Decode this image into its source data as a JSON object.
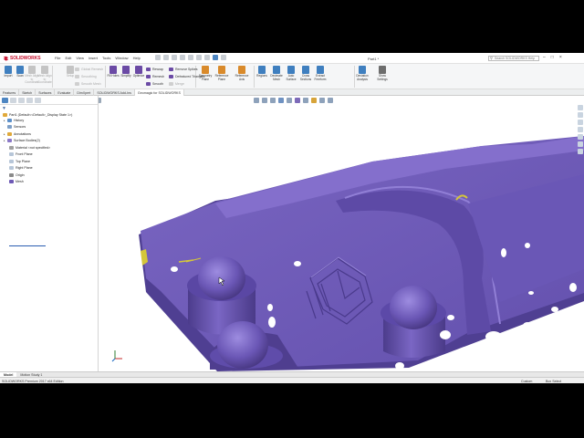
{
  "app": {
    "logo_text": "SOLIDWORKS",
    "menus": [
      "File",
      "Edit",
      "View",
      "Insert",
      "Tools",
      "Window",
      "Help"
    ],
    "document_title": "Part1 *",
    "search_placeholder": "Search SOLIDWORKS Help"
  },
  "ribbon": {
    "large_buttons": [
      {
        "label": "Import",
        "color": "#3f7fbf",
        "dim": false
      },
      {
        "label": "Scan",
        "color": "#3f7fbf",
        "dim": false
      },
      {
        "label": "Mesh Align to Coordinate",
        "color": "#c4c4c4",
        "dim": true
      },
      {
        "label": "Mesh Align to Coordinate",
        "color": "#c4c4c4",
        "dim": true
      },
      {
        "label": "Setup",
        "color": "#c4c4c4",
        "dim": true
      },
      {
        "label": "Fill Holes",
        "color": "#6b4aa5",
        "dim": false
      },
      {
        "label": "Simplify",
        "color": "#6b4aa5",
        "dim": false
      },
      {
        "label": "Optimize",
        "color": "#6b4aa5",
        "dim": false
      },
      {
        "label": "Symmetry Plane",
        "color": "#d98a2b",
        "dim": false
      },
      {
        "label": "Reference Plane",
        "color": "#d98a2b",
        "dim": false
      },
      {
        "label": "Reference Axis",
        "color": "#d98a2b",
        "dim": false
      },
      {
        "label": "Regions",
        "color": "#3f7fbf",
        "dim": false
      },
      {
        "label": "Decimate Mesh",
        "color": "#3f7fbf",
        "dim": false
      },
      {
        "label": "Auto Surface",
        "color": "#3f7fbf",
        "dim": false
      },
      {
        "label": "Cross Sections",
        "color": "#3f7fbf",
        "dim": false
      },
      {
        "label": "Extract Freeform",
        "color": "#3f7fbf",
        "dim": false
      },
      {
        "label": "Deviation Analysis",
        "color": "#3f7fbf",
        "dim": false
      },
      {
        "label": "Show Settings",
        "color": "#6d6d6d",
        "dim": false
      }
    ],
    "col_small_1": [
      {
        "label": "Global Remesh",
        "dim": true
      },
      {
        "label": "Smoothing",
        "dim": true
      },
      {
        "label": "Smooth Mesh",
        "dim": true
      }
    ],
    "col_small_2": [
      {
        "label": "Rewrap",
        "dim": false
      },
      {
        "label": "Remesh",
        "dim": false
      },
      {
        "label": "Smooth",
        "dim": false
      }
    ],
    "col_small_3": [
      {
        "label": "Remove Spikes",
        "dim": false
      },
      {
        "label": "Defeatured Triangles",
        "dim": false
      },
      {
        "label": "Merge",
        "dim": true
      }
    ]
  },
  "command_tabs": [
    "Features",
    "Sketch",
    "Surfaces",
    "Evaluate",
    "DimXpert",
    "SOLIDWORKS Add-Ins",
    "Geomagic for SOLIDWORKS"
  ],
  "active_command_tab": "Geomagic for SOLIDWORKS",
  "feature_tree": {
    "root": "Part1 (Default<<Default>_Display State 1>)",
    "items": [
      {
        "label": "History",
        "expand": true
      },
      {
        "label": "Sensors",
        "expand": false
      },
      {
        "label": "Annotations",
        "expand": true
      },
      {
        "label": "Surface Bodies(2)",
        "expand": true
      },
      {
        "label": "Material <not specified>",
        "expand": false
      },
      {
        "label": "Front Plane",
        "expand": false
      },
      {
        "label": "Top Plane",
        "expand": false
      },
      {
        "label": "Right Plane",
        "expand": false
      },
      {
        "label": "Origin",
        "expand": false
      },
      {
        "label": "Mesh",
        "expand": false
      }
    ]
  },
  "bottom_tabs": [
    "Model",
    "Motion Study 1"
  ],
  "active_bottom_tab": "Model",
  "status": {
    "left": "SOLIDWORKS Premium 2017 x64 Edition",
    "units": "Custom",
    "mode": "Box Select"
  },
  "colors": {
    "mesh_purple": "#6e5ab5",
    "mesh_dark": "#4e3d8f",
    "mesh_light": "#8b78cc",
    "accent_yellow": "#d4c63a",
    "selection_blue": "#2a5db0"
  }
}
